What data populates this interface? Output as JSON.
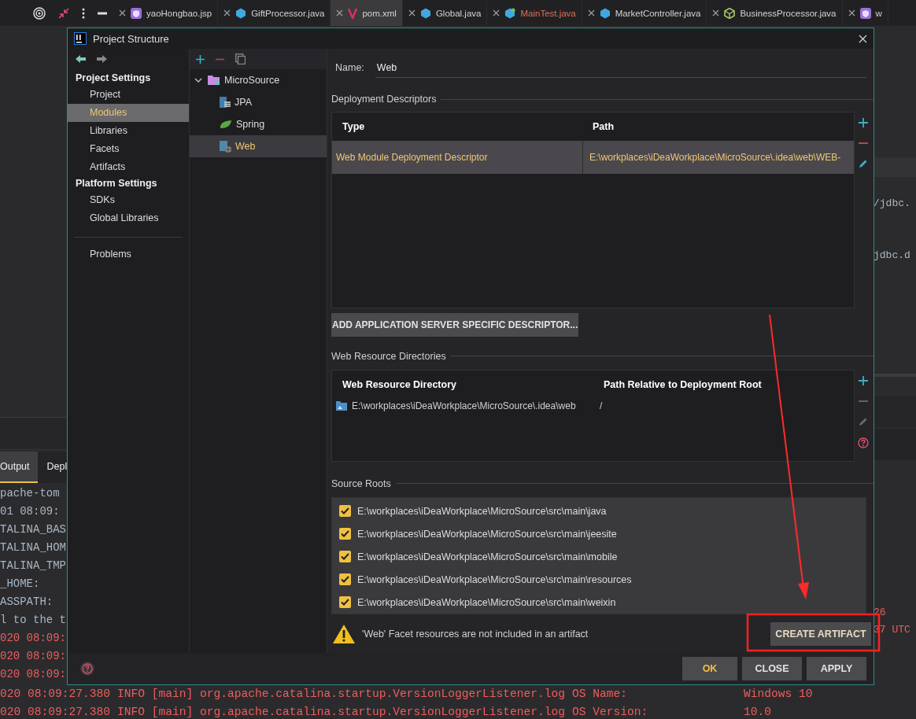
{
  "editor_tabs": [
    {
      "label": "yaoHongbao.jsp",
      "kind": "jsp",
      "selected": false,
      "color": "#d4d4d4"
    },
    {
      "label": "GiftProcessor.java",
      "kind": "java",
      "selected": false,
      "color": "#d4d4d4"
    },
    {
      "label": "pom.xml",
      "kind": "maven",
      "selected": true,
      "color": "#d4d4d4"
    },
    {
      "label": "Global.java",
      "kind": "java",
      "selected": false,
      "color": "#d4d4d4"
    },
    {
      "label": "MainTest.java",
      "kind": "test",
      "selected": false,
      "color": "#e0705a"
    },
    {
      "label": "MarketController.java",
      "kind": "java",
      "selected": false,
      "color": "#d4d4d4"
    },
    {
      "label": "BusinessProcessor.java",
      "kind": "bean",
      "selected": false,
      "color": "#d4d4d4"
    },
    {
      "label": "w",
      "kind": "jsp",
      "selected": false,
      "color": "#d4d4d4"
    }
  ],
  "tool_window": {
    "tabs": [
      {
        "label": "Output",
        "selected": true
      },
      {
        "label": "Depl",
        "selected": false
      }
    ],
    "log_lines": [
      {
        "text": "pache-tom",
        "kind": "plain"
      },
      {
        "text": "01 08:09:",
        "kind": "plain"
      },
      {
        "text": "TALINA_BAS",
        "kind": "plain"
      },
      {
        "text": "TALINA_HOM",
        "kind": "plain"
      },
      {
        "text": "TALINA_TMP",
        "kind": "plain"
      },
      {
        "text": "_HOME:",
        "kind": "plain"
      },
      {
        "text": "ASSPATH:",
        "kind": "plain"
      },
      {
        "text": "l to the t",
        "kind": "plain"
      },
      {
        "text": "020 08:09:",
        "kind": "error"
      },
      {
        "text": "020 08:09:",
        "kind": "error"
      },
      {
        "text": "020 08:09:",
        "kind": "error"
      }
    ]
  },
  "editor_fragments": [
    "/jdbc.",
    "jdbc.d"
  ],
  "right_log_fragments": [
    "26",
    "37 UTC"
  ],
  "bottom_log": [
    {
      "text": "020 08:09:27.380 INFO [main] org.apache.catalina.startup.VersionLoggerListener.log OS Name:",
      "value": "Windows 10"
    },
    {
      "text": "020 08:09:27.380 INFO [main] org.apache.catalina.startup.VersionLoggerListener.log OS Version:",
      "value": "10.0"
    }
  ],
  "dialog": {
    "title": "Project Structure",
    "nav": {
      "sections": [
        {
          "heading": "Project Settings",
          "items": [
            {
              "label": "Project",
              "selected": false
            },
            {
              "label": "Modules",
              "selected": true
            },
            {
              "label": "Libraries",
              "selected": false
            },
            {
              "label": "Facets",
              "selected": false
            },
            {
              "label": "Artifacts",
              "selected": false
            }
          ]
        },
        {
          "heading": "Platform Settings",
          "items": [
            {
              "label": "SDKs",
              "selected": false
            },
            {
              "label": "Global Libraries",
              "selected": false
            }
          ]
        },
        {
          "items": [
            {
              "label": "Problems",
              "selected": false
            }
          ]
        }
      ]
    },
    "tree": [
      {
        "label": "MicroSource",
        "kind": "module",
        "expanded": true,
        "selected": false,
        "children": [
          {
            "label": "JPA",
            "kind": "jpa",
            "selected": false
          },
          {
            "label": "Spring",
            "kind": "spring",
            "selected": false
          },
          {
            "label": "Web",
            "kind": "web",
            "selected": true
          }
        ]
      }
    ],
    "name_field": {
      "label": "Name:",
      "value": "Web"
    },
    "deployment_descriptors": {
      "title": "Deployment Descriptors",
      "columns": [
        "Type",
        "Path"
      ],
      "rows": [
        {
          "cells": [
            "Web Module Deployment Descriptor",
            "E:\\workplaces\\iDeaWorkplace\\MicroSource\\.idea\\web\\WEB-"
          ],
          "selected": true
        }
      ],
      "actions": [
        {
          "kind": "add",
          "disabled": false
        },
        {
          "kind": "remove",
          "disabled": false
        },
        {
          "kind": "edit",
          "disabled": false
        }
      ],
      "button": "ADD APPLICATION SERVER SPECIFIC DESCRIPTOR..."
    },
    "web_resource_directories": {
      "title": "Web Resource Directories",
      "columns": [
        "Web Resource Directory",
        "Path Relative to Deployment Root"
      ],
      "rows": [
        {
          "cells": [
            "E:\\workplaces\\iDeaWorkplace\\MicroSource\\.idea\\web",
            "/"
          ],
          "selected": false
        }
      ],
      "actions": [
        {
          "kind": "add",
          "disabled": false
        },
        {
          "kind": "remove",
          "disabled": true
        },
        {
          "kind": "edit",
          "disabled": true
        },
        {
          "kind": "help",
          "disabled": false
        }
      ]
    },
    "source_roots": {
      "title": "Source Roots",
      "items": [
        {
          "path": "E:\\workplaces\\iDeaWorkplace\\MicroSource\\src\\main\\java",
          "checked": true
        },
        {
          "path": "E:\\workplaces\\iDeaWorkplace\\MicroSource\\src\\main\\jeesite",
          "checked": true
        },
        {
          "path": "E:\\workplaces\\iDeaWorkplace\\MicroSource\\src\\main\\mobile",
          "checked": true
        },
        {
          "path": "E:\\workplaces\\iDeaWorkplace\\MicroSource\\src\\main\\resources",
          "checked": true
        },
        {
          "path": "E:\\workplaces\\iDeaWorkplace\\MicroSource\\src\\main\\weixin",
          "checked": true
        }
      ]
    },
    "warning": {
      "text": "'Web' Facet resources are not included in an artifact",
      "button": "CREATE ARTIFACT"
    },
    "buttons": [
      {
        "label": "OK",
        "default": true
      },
      {
        "label": "CLOSE",
        "default": false
      },
      {
        "label": "APPLY",
        "default": false
      }
    ]
  }
}
